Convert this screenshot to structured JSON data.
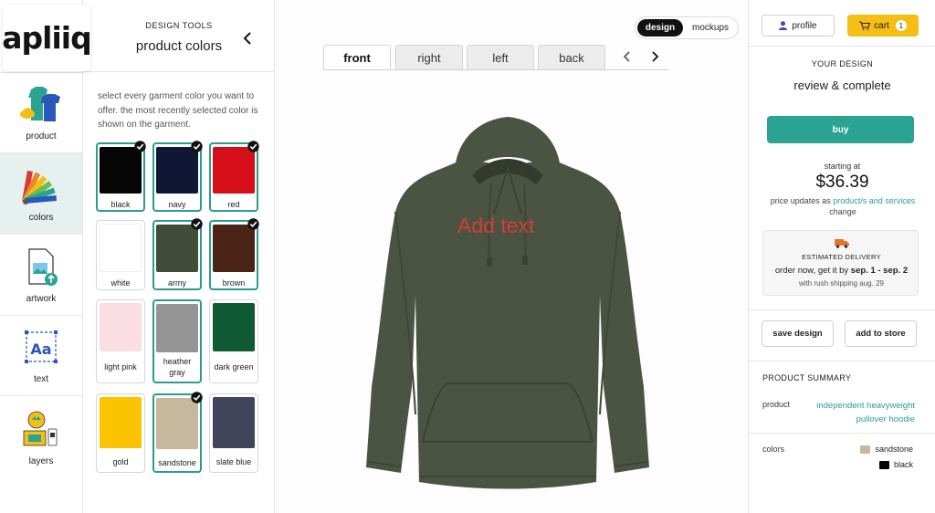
{
  "brand": {
    "logo_text": "apliiq"
  },
  "nav": {
    "items": [
      {
        "label": "product",
        "icon": "garments-icon"
      },
      {
        "label": "colors",
        "icon": "color-fan-icon",
        "active": true
      },
      {
        "label": "artwork",
        "icon": "artwork-upload-icon"
      },
      {
        "label": "text",
        "icon": "text-aa-icon"
      },
      {
        "label": "layers",
        "icon": "layers-icon"
      }
    ]
  },
  "color_panel": {
    "eyebrow": "DESIGN TOOLS",
    "title": "product colors",
    "description": "select every garment color you want to offer. the most recently selected color is shown on the garment.",
    "swatches": [
      {
        "name": "black",
        "hex": "#050505",
        "selected": true,
        "checked": true
      },
      {
        "name": "navy",
        "hex": "#101734",
        "selected": true,
        "checked": true
      },
      {
        "name": "red",
        "hex": "#d60e1a",
        "selected": true,
        "checked": true
      },
      {
        "name": "white",
        "hex": "#ffffff",
        "selected": false,
        "checked": false
      },
      {
        "name": "army",
        "hex": "#414d39",
        "selected": true,
        "checked": true
      },
      {
        "name": "brown",
        "hex": "#4a2416",
        "selected": true,
        "checked": true
      },
      {
        "name": "light pink",
        "hex": "#fbdde4",
        "selected": false,
        "checked": false
      },
      {
        "name": "heather gray",
        "hex": "#959595",
        "selected": true,
        "checked": false
      },
      {
        "name": "dark green",
        "hex": "#0f5a34",
        "selected": false,
        "checked": false
      },
      {
        "name": "gold",
        "hex": "#fcc400",
        "selected": false,
        "checked": false
      },
      {
        "name": "sandstone",
        "hex": "#c7b79c",
        "selected": true,
        "checked": true
      },
      {
        "name": "slate blue",
        "hex": "#41445a",
        "selected": false,
        "checked": false
      }
    ]
  },
  "canvas": {
    "mode_toggle": {
      "design": "design",
      "mockups": "mockups",
      "active": "design"
    },
    "views": [
      {
        "label": "front",
        "active": true
      },
      {
        "label": "right",
        "active": false
      },
      {
        "label": "left",
        "active": false
      },
      {
        "label": "back",
        "active": false
      }
    ],
    "garment_text": "Add text",
    "garment_color": "#4b5442"
  },
  "right_panel": {
    "profile_label": "profile",
    "cart_label": "cart",
    "cart_count": "1",
    "eyebrow": "YOUR DESIGN",
    "title": "review & complete",
    "buy_label": "buy",
    "starting_at": "starting at",
    "price": "$36.39",
    "price_note_prefix": "price updates as",
    "price_note_link": "product/s and services",
    "price_note_suffix": "change",
    "delivery": {
      "eyebrow": "ESTIMATED DELIVERY",
      "line_prefix": "order now, get it by",
      "line_dates": "sep. 1 - sep. 2",
      "rush": "with rush shipping aug. 29"
    },
    "save_label": "save design",
    "add_store_label": "add to store",
    "summary": {
      "title": "PRODUCT SUMMARY",
      "product_key": "product",
      "product_value_line1": "independent heavyweight",
      "product_value_line2": "pullover hoodie",
      "colors_key": "colors",
      "colors": [
        {
          "name": "sandstone",
          "hex": "#c7b79c"
        },
        {
          "name": "black",
          "hex": "#050505"
        }
      ]
    }
  },
  "colors": {
    "accent": "#2a9d8f",
    "cart": "#f5be14",
    "buy": "#2aa391"
  }
}
